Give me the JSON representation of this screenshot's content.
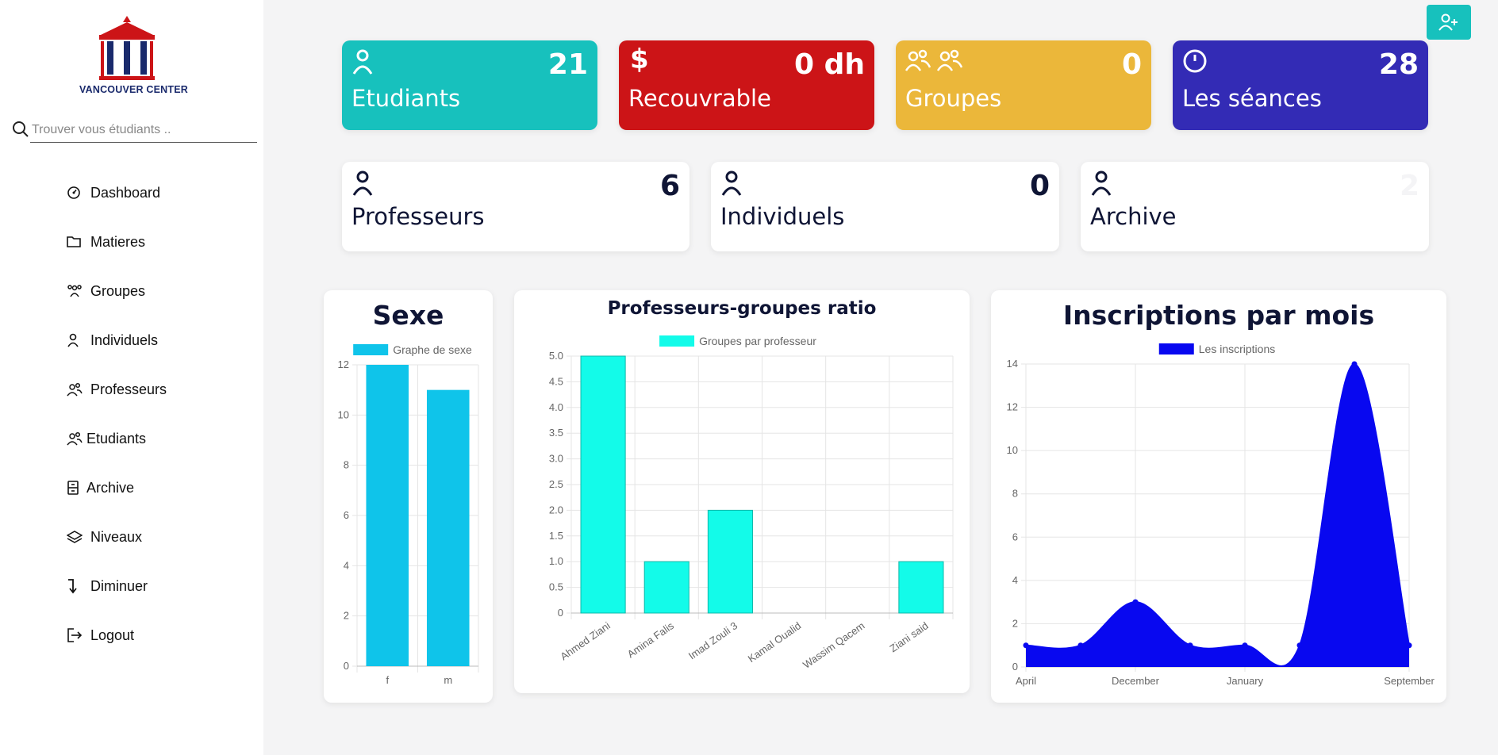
{
  "logo": {
    "text": "VANCOUVER CENTER"
  },
  "search": {
    "placeholder": "Trouver vous étudiants .."
  },
  "nav": [
    {
      "label": "Dashboard",
      "icon": "gauge-icon"
    },
    {
      "label": "Matieres",
      "icon": "folder-icon"
    },
    {
      "label": "Groupes",
      "icon": "group-icon"
    },
    {
      "label": "Individuels",
      "icon": "user-icon"
    },
    {
      "label": "Professeurs",
      "icon": "users-icon"
    },
    {
      "label": "Etudiants",
      "icon": "users-icon"
    },
    {
      "label": "Archive",
      "icon": "archive-icon"
    },
    {
      "label": "Niveaux",
      "icon": "layers-icon"
    },
    {
      "label": "Diminuer",
      "icon": "arrow-turn-down-icon"
    },
    {
      "label": "Logout",
      "icon": "logout-icon"
    }
  ],
  "stats": {
    "etudiants": {
      "title": "Etudiants",
      "value": "21",
      "color": "#17c1bd"
    },
    "recouvrable": {
      "title": "Recouvrable",
      "value": "0 dh",
      "color": "#cc1417"
    },
    "groupes": {
      "title": "Groupes",
      "value": "0",
      "color": "#ebb73a"
    },
    "seances": {
      "title": "Les séances",
      "value": "28",
      "color": "#332bb5"
    },
    "professeurs": {
      "title": "Professeurs",
      "value": "6"
    },
    "individuels": {
      "title": "Individuels",
      "value": "0"
    },
    "archive": {
      "title": "Archive",
      "value": "2"
    }
  },
  "chart_data": [
    {
      "type": "bar",
      "title": "Sexe",
      "categories": [
        "f",
        "m"
      ],
      "series": [
        {
          "name": "Graphe de sexe",
          "values": [
            12,
            11
          ],
          "color": "#0fc4ea"
        }
      ],
      "yticks": [
        "0",
        "2",
        "4",
        "6",
        "8",
        "10",
        "12"
      ],
      "ylim": [
        0,
        12
      ],
      "grid": true,
      "legend": "top"
    },
    {
      "type": "bar",
      "title": "Professeurs-groupes ratio",
      "categories": [
        "Ahmed Ziani",
        "Amina Falis",
        "Imad Zouli 3",
        "Kamal Oualid",
        "Wassim Qacem",
        "Ziani said"
      ],
      "series": [
        {
          "name": "Groupes par professeur",
          "values": [
            5,
            1,
            2,
            0,
            0,
            1
          ],
          "color": "#13fbe9"
        }
      ],
      "yticks": [
        "0",
        "0.5",
        "1.0",
        "1.5",
        "2.0",
        "2.5",
        "3.0",
        "3.5",
        "4.0",
        "4.5",
        "5.0"
      ],
      "ylim": [
        0,
        5
      ],
      "grid": true,
      "legend": "top"
    },
    {
      "type": "area",
      "title": "Inscriptions par mois",
      "x": [
        "April",
        "",
        "December",
        "",
        "January",
        "",
        "",
        "September"
      ],
      "xtick_labels": [
        "April",
        "December",
        "January",
        "September"
      ],
      "series": [
        {
          "name": "Les inscriptions",
          "values": [
            1,
            1,
            3,
            1,
            1,
            1,
            14,
            1
          ],
          "color": "#0808f0"
        }
      ],
      "yticks": [
        "0",
        "2",
        "4",
        "6",
        "8",
        "10",
        "12",
        "14"
      ],
      "ylim": [
        0,
        14
      ],
      "grid": true,
      "legend": "top"
    }
  ]
}
